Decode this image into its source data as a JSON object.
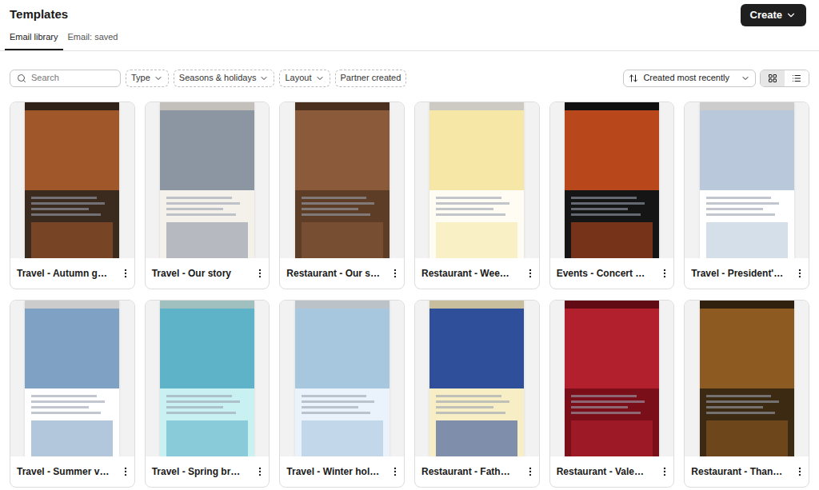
{
  "page": {
    "title": "Templates"
  },
  "create_button": {
    "label": "Create"
  },
  "tabs": [
    {
      "label": "Email library",
      "selected": true
    },
    {
      "label": "Email: saved",
      "selected": false
    }
  ],
  "search": {
    "placeholder": "Search"
  },
  "filters": [
    {
      "label": "Type",
      "kind": "dropdown"
    },
    {
      "label": "Seasons & holidays",
      "kind": "dropdown"
    },
    {
      "label": "Layout",
      "kind": "dropdown"
    },
    {
      "label": "Partner created",
      "kind": "toggle"
    }
  ],
  "sort": {
    "label": "Created most recently"
  },
  "view_toggle": [
    {
      "kind": "grid",
      "selected": true
    },
    {
      "kind": "list",
      "selected": false
    }
  ],
  "templates": [
    {
      "name": "Travel - Autumn g…",
      "color": "#3b2a1e",
      "accent": "#a0582a"
    },
    {
      "name": "Travel - Our story",
      "color": "#f4f1ea",
      "accent": "#8c96a3"
    },
    {
      "name": "Restaurant - Our s…",
      "color": "#5e3d27",
      "accent": "#8a5a3a"
    },
    {
      "name": "Restaurant - Wee…",
      "color": "#fffdf3",
      "accent": "#f6e7a6"
    },
    {
      "name": "Events - Concert …",
      "color": "#151515",
      "accent": "#b8481c"
    },
    {
      "name": "Travel - President'…",
      "color": "#ffffff",
      "accent": "#b9c9db"
    },
    {
      "name": "Travel - Summer v…",
      "color": "#ffffff",
      "accent": "#7fa2c4"
    },
    {
      "name": "Travel - Spring br…",
      "color": "#c9f1f1",
      "accent": "#5fb3c9"
    },
    {
      "name": "Travel - Winter hol…",
      "color": "#eaf3fb",
      "accent": "#a7c7df"
    },
    {
      "name": "Restaurant - Fath…",
      "color": "#f8eec5",
      "accent": "#2f4f9a"
    },
    {
      "name": "Restaurant - Vale…",
      "color": "#7a0f1a",
      "accent": "#b3202d"
    },
    {
      "name": "Restaurant - Than…",
      "color": "#3d2a12",
      "accent": "#8d5b22"
    }
  ]
}
